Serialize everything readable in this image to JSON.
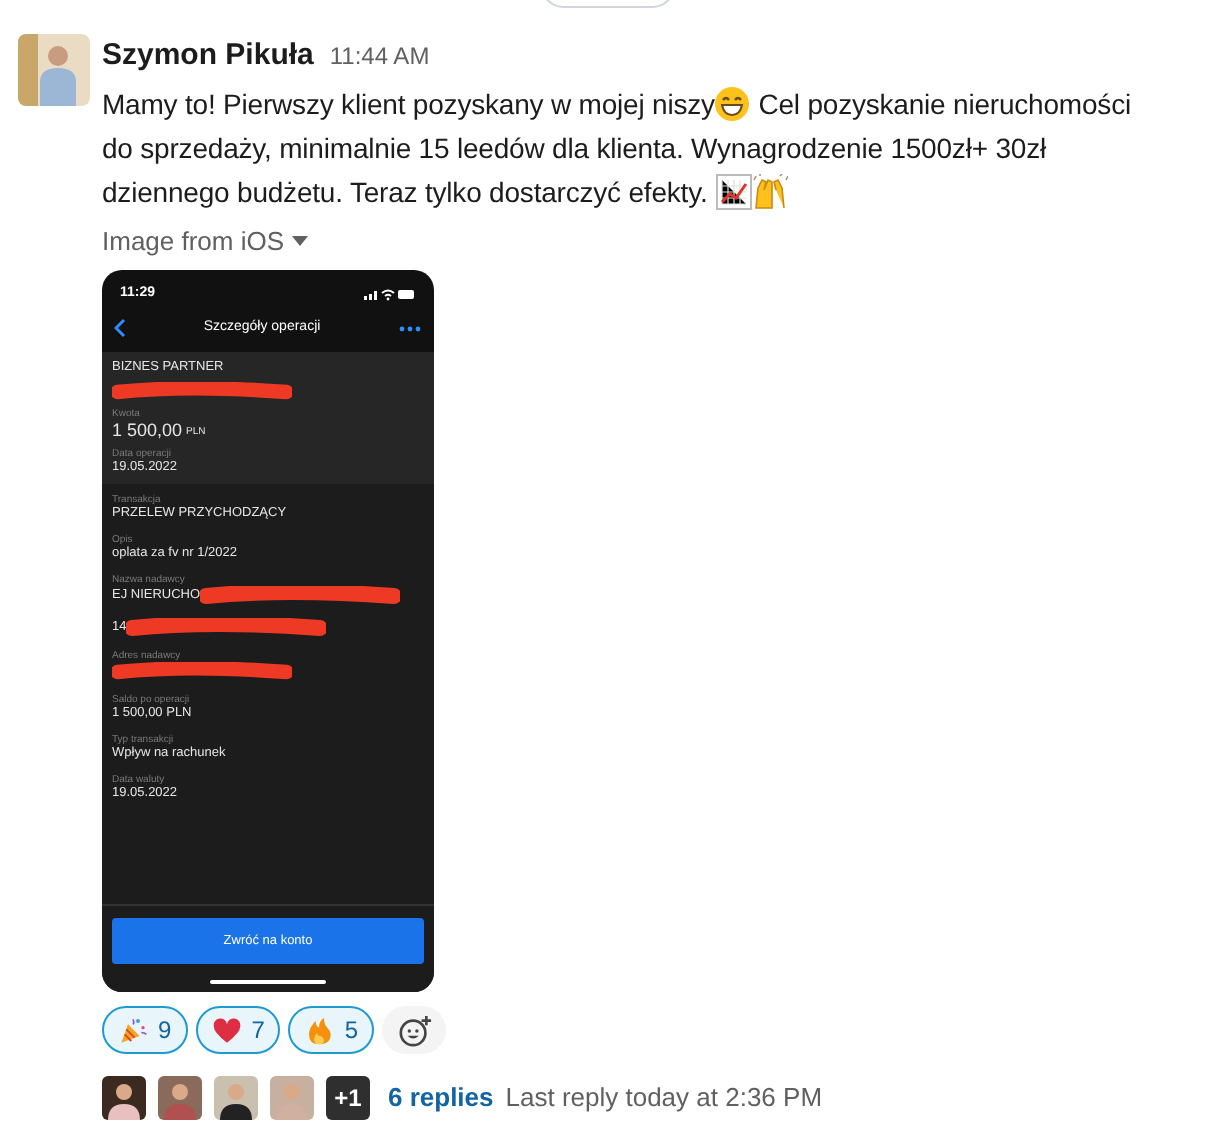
{
  "message": {
    "author": "Szymon Pikuła",
    "time": "11:44 AM",
    "body": [
      [
        {
          "kind": "text",
          "text": "Mamy to! Pierwszy klient pozyskany w mojej niszy"
        },
        {
          "kind": "grin"
        },
        {
          "kind": "text",
          "text": " Cel pozyskanie nieruchomości"
        }
      ],
      [
        {
          "kind": "text",
          "text": "do sprzedaży, minimalnie 15 leedów dla klienta. Wynagrodzenie 1500zł+ 30zł"
        }
      ],
      [
        {
          "kind": "text",
          "text": "dziennego budżetu. Teraz tylko dostarczyć efekty. "
        },
        {
          "kind": "chart"
        },
        {
          "kind": "hands"
        }
      ]
    ],
    "attachment_label": "Image from iOS"
  },
  "phone": {
    "clock": "11:29",
    "title": "Szczegóły operacji",
    "sections": [
      [
        {
          "value": "BIZNES PARTNER"
        },
        {
          "redacted": true
        },
        {
          "label": "Kwota",
          "value": "1 500,00",
          "unit": "PLN"
        },
        {
          "label": "Data operacji",
          "value": "19.05.2022"
        }
      ],
      [
        {
          "label": "Transakcja",
          "value": "PRZELEW PRZYCHODZĄCY"
        },
        {
          "label": "Opis",
          "value": "oplata za fv nr 1/2022"
        },
        {
          "label": "Nazwa nadawcy",
          "value": "EJ NIERUCHO",
          "redacted": true
        },
        {
          "value": "14",
          "redacted": true
        },
        {
          "label": "Adres nadawcy",
          "redacted": true
        },
        {
          "label": "Saldo po operacji",
          "value": "1 500,00 PLN"
        },
        {
          "label": "Typ transakcji",
          "value": "Wpływ na rachunek"
        },
        {
          "label": "Data waluty",
          "value": "19.05.2022"
        }
      ]
    ],
    "button": "Zwróć na konto"
  },
  "reactions": [
    {
      "kind": "party",
      "count": "9",
      "selected": true
    },
    {
      "kind": "heart",
      "count": "7",
      "selected": true
    },
    {
      "kind": "fire",
      "count": "5",
      "selected": true
    }
  ],
  "thread": {
    "avatars": [
      {
        "kind": "person"
      },
      {
        "kind": "person"
      },
      {
        "kind": "person"
      },
      {
        "kind": "person"
      },
      {
        "kind": "more",
        "text": "+1"
      }
    ],
    "replies": "6 replies",
    "last_reply": "Last reply today at 2:36 PM"
  }
}
